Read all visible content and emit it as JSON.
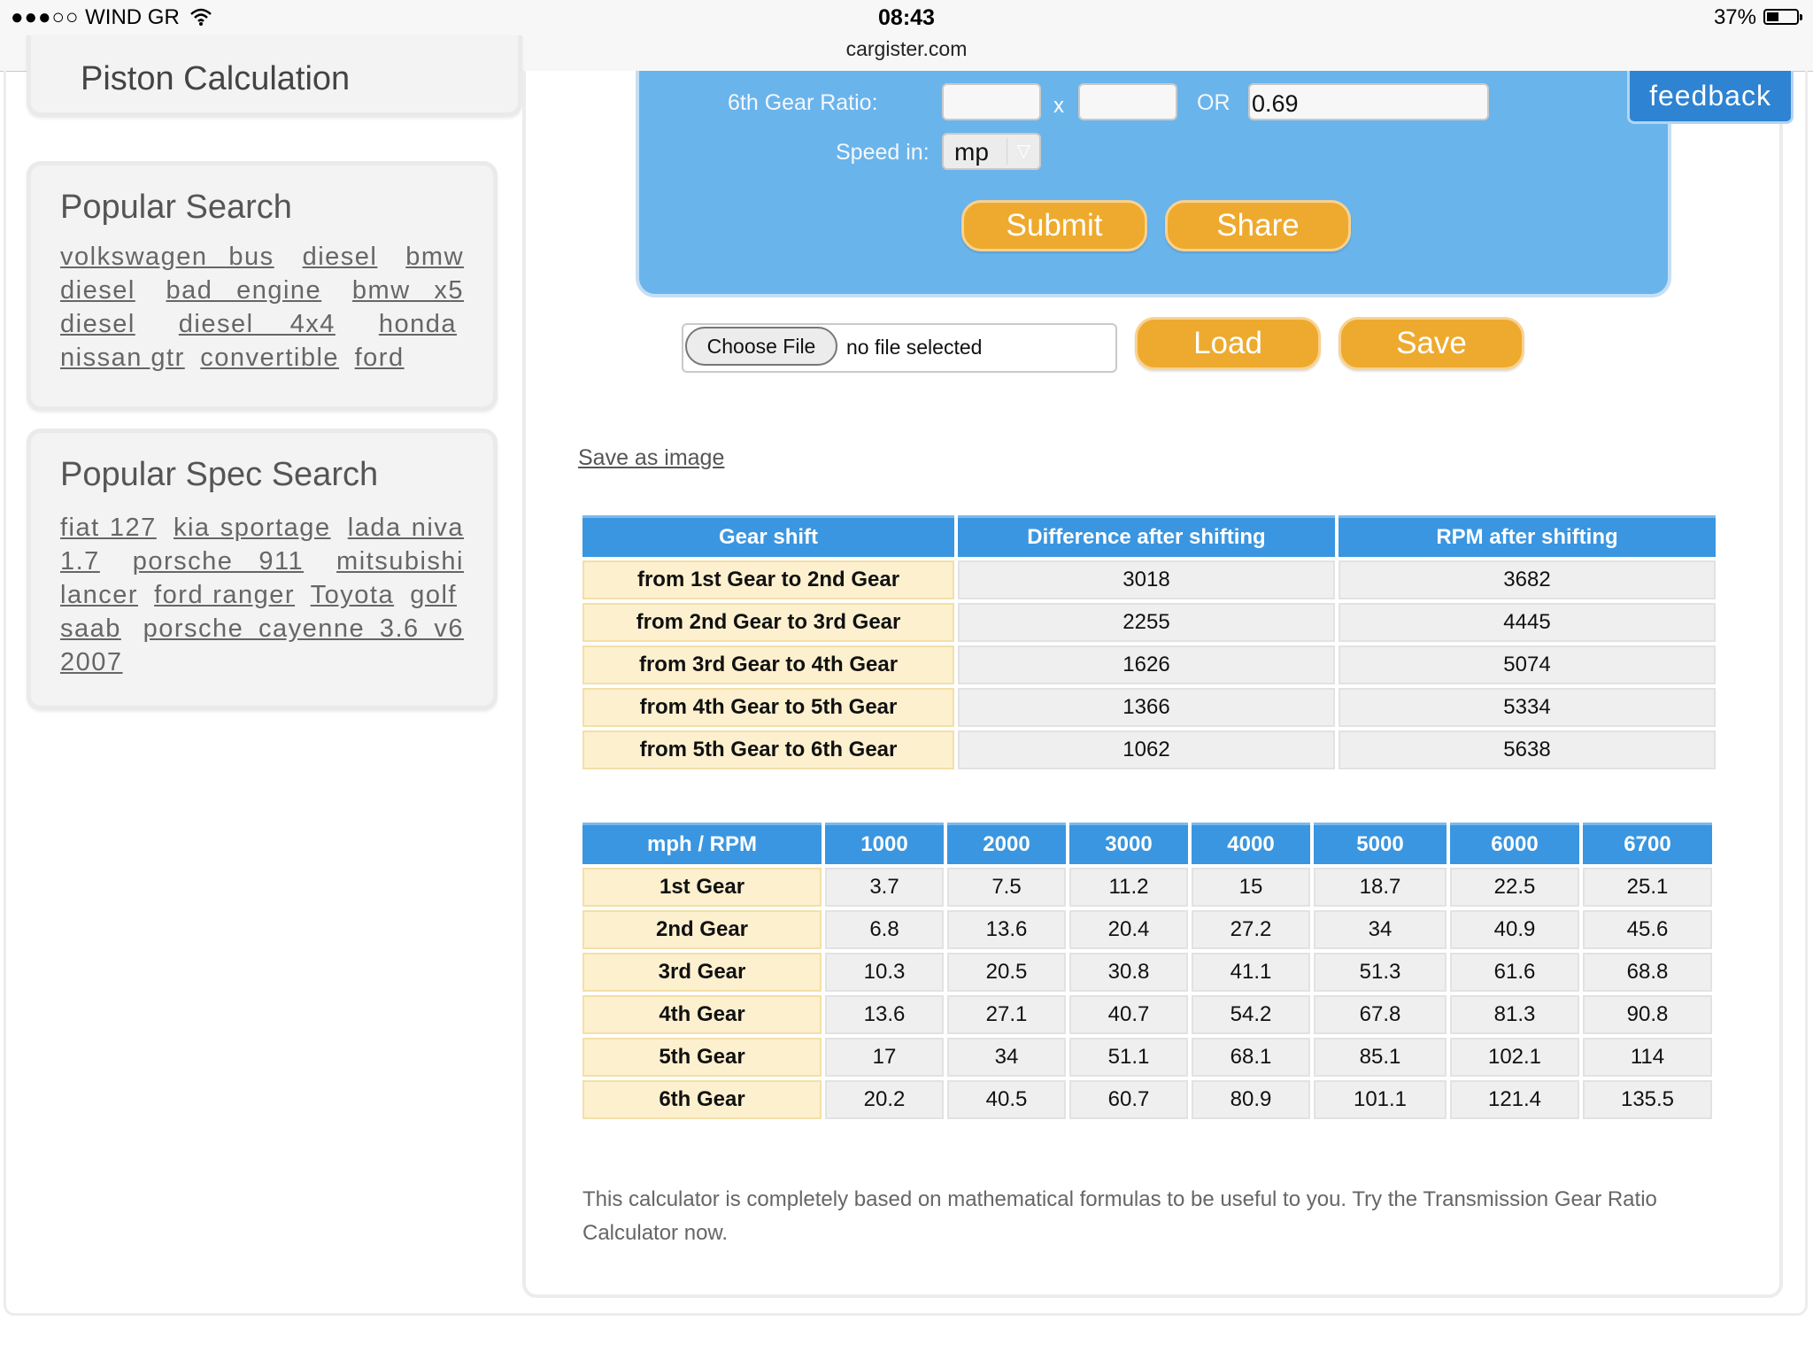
{
  "status_bar": {
    "carrier_dots": "●●●○○",
    "carrier": "WIND GR",
    "time": "08:43",
    "url": "cargister.com",
    "battery": "37%"
  },
  "sidebar": {
    "piston_title": "Piston Calculation",
    "popular_search": {
      "title": "Popular Search",
      "links": [
        "volkswagen bus",
        "diesel",
        "bmw diesel",
        "bad engine",
        "bmw x5 diesel",
        "diesel 4x4",
        "honda",
        "nissan gtr",
        "convertible",
        "ford"
      ]
    },
    "popular_spec_search": {
      "title": "Popular Spec Search",
      "links": [
        "fiat 127",
        "kia sportage",
        "lada niva 1.7",
        "porsche 911",
        "mitsubishi lancer",
        "ford ranger",
        "Toyota",
        "golf",
        "saab",
        "porsche cayenne 3.6 v6 2007"
      ]
    }
  },
  "calculator": {
    "sixth_gear_label": "6th Gear Ratio:",
    "sixth_gear_input1": "",
    "sixth_gear_input2": "",
    "times": "x",
    "or": "OR",
    "sixth_gear_ratio": "0.69",
    "speed_label": "Speed in:",
    "speed_value": "mp",
    "submit": "Submit",
    "share": "Share"
  },
  "feedback": "feedback",
  "file": {
    "choose": "Choose File",
    "status": "no file selected",
    "load": "Load",
    "save": "Save"
  },
  "save_as_image": "Save as image",
  "shift_table": {
    "headers": [
      "Gear shift",
      "Difference after shifting",
      "RPM after shifting"
    ],
    "rows": [
      [
        "from 1st Gear to 2nd Gear",
        "3018",
        "3682"
      ],
      [
        "from 2nd Gear to 3rd Gear",
        "2255",
        "4445"
      ],
      [
        "from 3rd Gear to 4th Gear",
        "1626",
        "5074"
      ],
      [
        "from 4th Gear to 5th Gear",
        "1366",
        "5334"
      ],
      [
        "from 5th Gear to 6th Gear",
        "1062",
        "5638"
      ]
    ]
  },
  "speed_table": {
    "headers": [
      "mph / RPM",
      "1000",
      "2000",
      "3000",
      "4000",
      "5000",
      "6000",
      "6700"
    ],
    "rows": [
      [
        "1st Gear",
        "3.7",
        "7.5",
        "11.2",
        "15",
        "18.7",
        "22.5",
        "25.1"
      ],
      [
        "2nd Gear",
        "6.8",
        "13.6",
        "20.4",
        "27.2",
        "34",
        "40.9",
        "45.6"
      ],
      [
        "3rd Gear",
        "10.3",
        "20.5",
        "30.8",
        "41.1",
        "51.3",
        "61.6",
        "68.8"
      ],
      [
        "4th Gear",
        "13.6",
        "27.1",
        "40.7",
        "54.2",
        "67.8",
        "81.3",
        "90.8"
      ],
      [
        "5th Gear",
        "17",
        "34",
        "51.1",
        "68.1",
        "85.1",
        "102.1",
        "114"
      ],
      [
        "6th Gear",
        "20.2",
        "40.5",
        "60.7",
        "80.9",
        "101.1",
        "121.4",
        "135.5"
      ]
    ]
  },
  "footer_note": "This calculator is completely based on mathematical formulas to be useful to you. Try the Transmission Gear Ratio Calculator now.",
  "colors": {
    "calc_blue": "#6ab4ec",
    "header_blue": "#3a96e0",
    "orange": "#eeaa2e",
    "row_head": "#fdf0cf",
    "feedback_blue": "#2e83d2"
  }
}
